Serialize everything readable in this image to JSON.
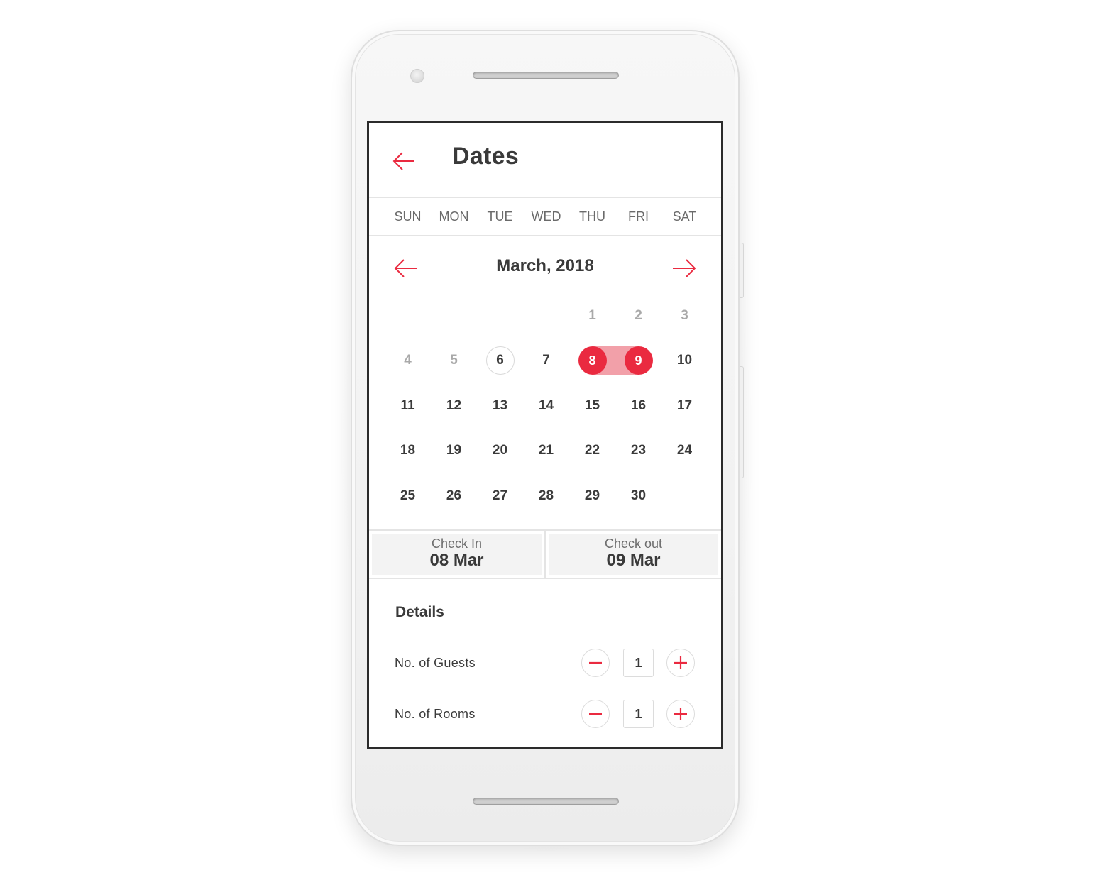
{
  "header": {
    "title": "Dates",
    "back_icon": "arrow-left-icon"
  },
  "weekdays": [
    "SUN",
    "MON",
    "TUE",
    "WED",
    "THU",
    "FRI",
    "SAT"
  ],
  "calendar": {
    "month_label": "March, 2018",
    "prev_icon": "arrow-left-icon",
    "next_icon": "arrow-right-icon",
    "today": 6,
    "range_start": 8,
    "range_end": 9,
    "weeks": [
      [
        null,
        null,
        null,
        null,
        1,
        2,
        3
      ],
      [
        4,
        5,
        6,
        7,
        8,
        9,
        10
      ],
      [
        11,
        12,
        13,
        14,
        15,
        16,
        17
      ],
      [
        18,
        19,
        20,
        21,
        22,
        23,
        24
      ],
      [
        25,
        26,
        27,
        28,
        29,
        30,
        null
      ]
    ],
    "muted_days": [
      1,
      2,
      3,
      4,
      5
    ]
  },
  "check": {
    "in_label": "Check In",
    "in_value": "08 Mar",
    "out_label": "Check out",
    "out_value": "09 Mar"
  },
  "details": {
    "title": "Details",
    "guests": {
      "label": "No. of Guests",
      "value": "1"
    },
    "rooms": {
      "label": "No. of Rooms",
      "value": "1"
    }
  },
  "colors": {
    "accent": "#ea2a40",
    "range": "#f2a0a9",
    "text": "#3a3a3a",
    "muted": "#a9a9a9"
  }
}
